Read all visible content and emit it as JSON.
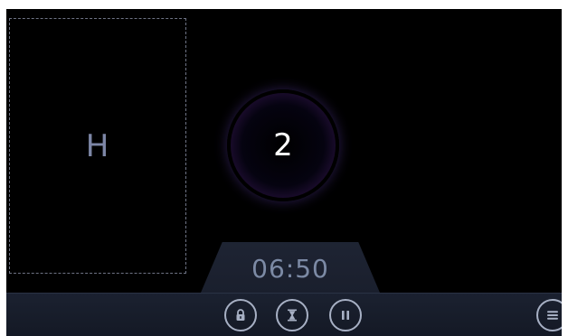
{
  "zone": {
    "label": "H"
  },
  "counter": {
    "value": "2"
  },
  "timer": {
    "time": "06:50"
  },
  "toolbar": {
    "buttons": [
      {
        "icon": "lock-icon"
      },
      {
        "icon": "hourglass-icon"
      },
      {
        "icon": "pause-icon"
      },
      {
        "icon": "menu-icon"
      }
    ]
  },
  "colors": {
    "background": "#000000",
    "bar": "#1b2130",
    "icon_stroke": "#a7b0c4",
    "timer_text": "#7c8aa5",
    "zone_text": "#7d86a6",
    "orb_blue": "#5a6ff5",
    "orb_red": "#e0406c"
  }
}
